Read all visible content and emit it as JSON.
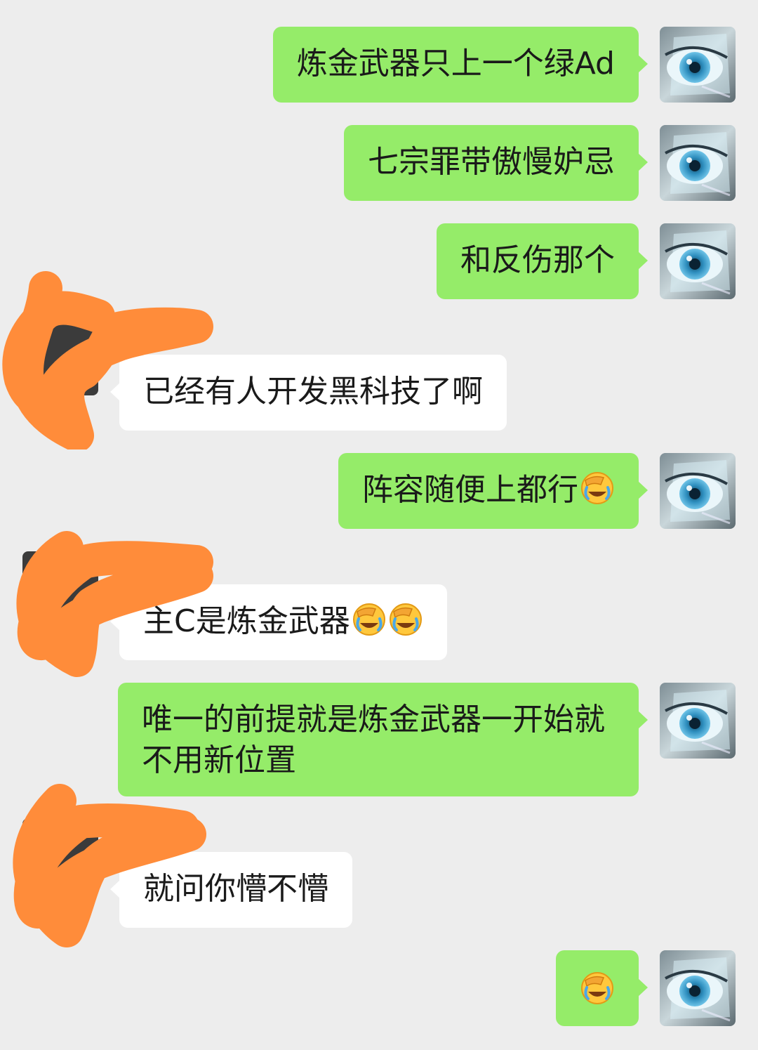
{
  "messages": [
    {
      "side": "self",
      "text": "炼金武器只上一个绿Ad",
      "emoji_count": 0
    },
    {
      "side": "self",
      "text": "七宗罪带傲慢妒忌",
      "emoji_count": 0
    },
    {
      "side": "self",
      "text": "和反伤那个",
      "emoji_count": 0
    },
    {
      "side": "peer",
      "text": "已经有人开发黑科技了啊",
      "emoji_count": 0
    },
    {
      "side": "self",
      "text": "阵容随便上都行",
      "emoji_count": 1
    },
    {
      "side": "peer",
      "text": "主C是炼金武器",
      "emoji_count": 2
    },
    {
      "side": "self",
      "text": "唯一的前提就是炼金武器一开始就\n不用新位置",
      "emoji_count": 0
    },
    {
      "side": "peer",
      "text": "就问你懵不懵",
      "emoji_count": 0
    },
    {
      "side": "self",
      "text": "",
      "emoji_count": 1
    }
  ],
  "emoji": {
    "name": "facepalm-laugh-emoji"
  },
  "colors": {
    "background": "#ededed",
    "self_bubble": "#95ec69",
    "peer_bubble": "#ffffff",
    "redaction": "#ff8c3a"
  }
}
